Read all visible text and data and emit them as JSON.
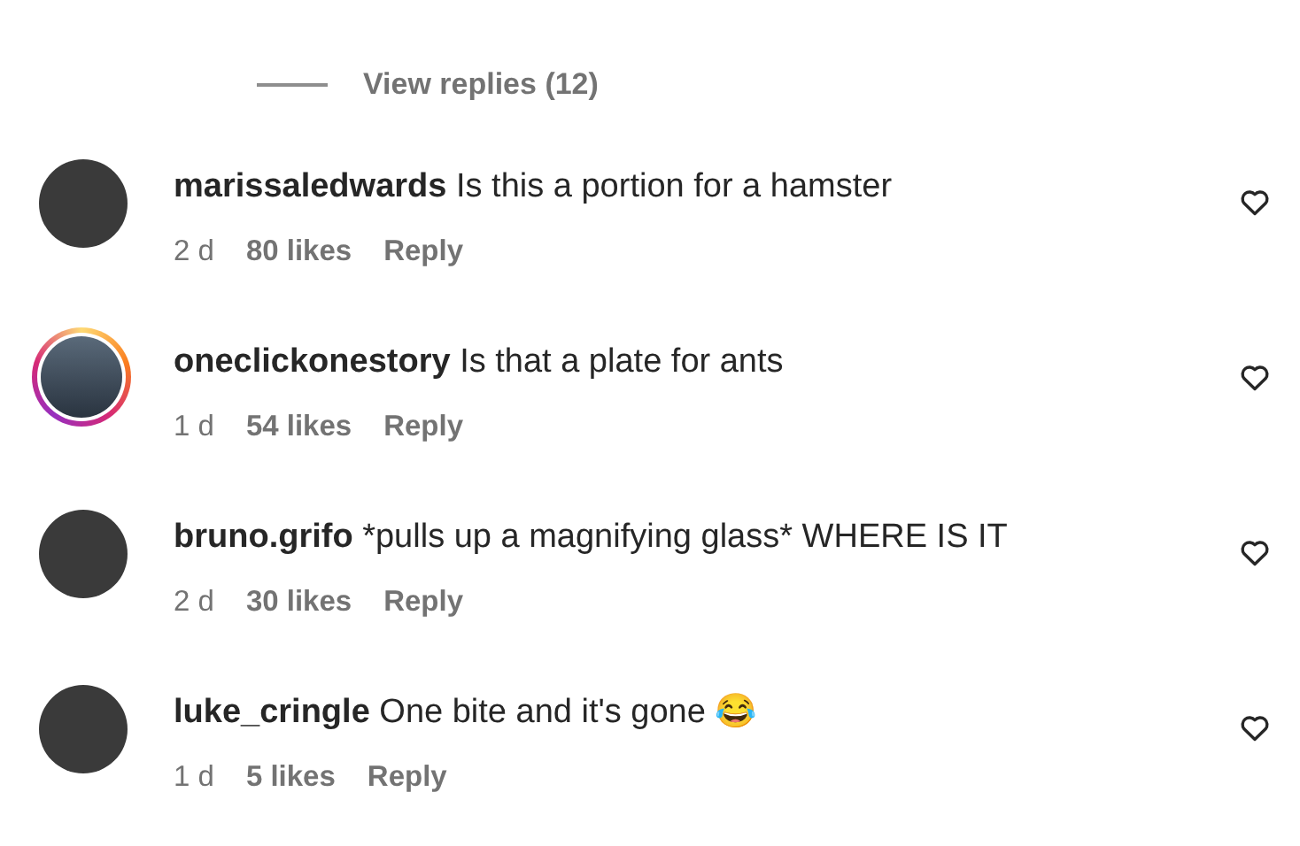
{
  "view_replies": {
    "label": "View replies (12)"
  },
  "comments": [
    {
      "username": "marissaledwards",
      "text": "Is this a portion for a hamster",
      "time": "2 d",
      "likes": "80 likes",
      "reply": "Reply",
      "story_ring": false
    },
    {
      "username": "oneclickonestory",
      "text": "Is that a plate for ants",
      "time": "1 d",
      "likes": "54 likes",
      "reply": "Reply",
      "story_ring": true
    },
    {
      "username": "bruno.grifo",
      "text": "*pulls up a magnifying glass* WHERE IS IT",
      "time": "2 d",
      "likes": "30 likes",
      "reply": "Reply",
      "story_ring": false
    },
    {
      "username": "luke_cringle",
      "text": "One bite and it's gone 😂",
      "time": "1 d",
      "likes": "5 likes",
      "reply": "Reply",
      "story_ring": false
    }
  ]
}
